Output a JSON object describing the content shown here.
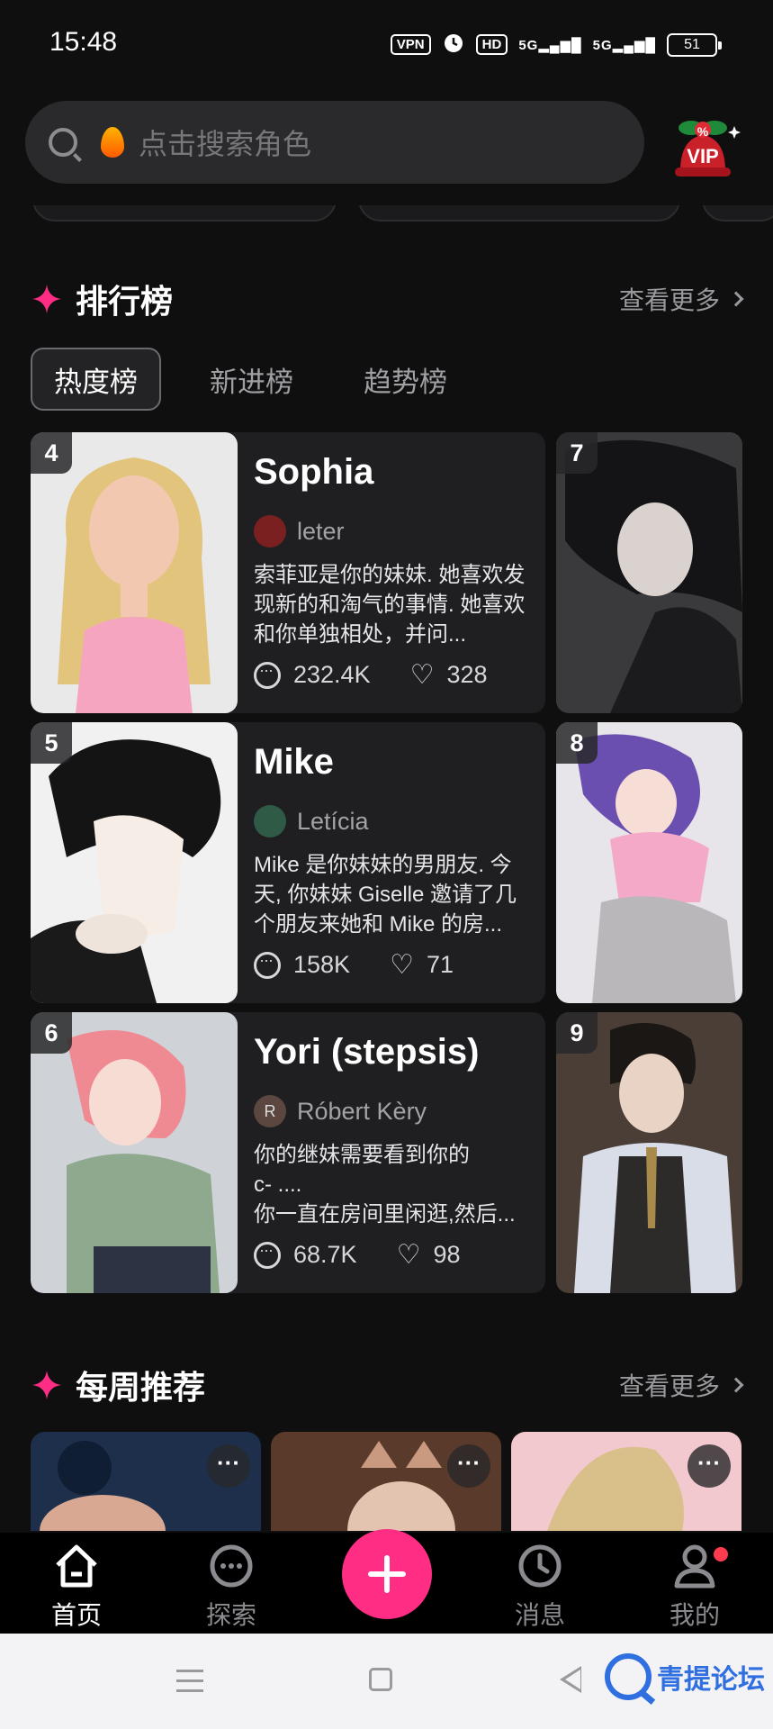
{
  "status": {
    "time": "15:48",
    "vpn": "VPN",
    "hd": "HD",
    "sig1": "5G",
    "sig2": "5G",
    "battery": "51"
  },
  "search": {
    "placeholder": "点击搜索角色"
  },
  "vip": {
    "label": "VIP",
    "badge": "%"
  },
  "ranking": {
    "title": "排行榜",
    "more": "查看更多",
    "tabs": [
      "热度榜",
      "新进榜",
      "趋势榜"
    ],
    "cards": [
      {
        "rank": "4",
        "name": "Sophia",
        "author": "leter",
        "desc": "索菲亚是你的妹妹. 她喜欢发现新的和淘气的事情. 她喜欢和你单独相处，并问...",
        "chats": "232.4K",
        "likes": "328"
      },
      {
        "rank": "5",
        "name": "Mike",
        "author": "Letícia",
        "desc": "Mike 是你妹妹的男朋友. 今天, 你妹妹 Giselle 邀请了几个朋友来她和 Mike 的房...",
        "chats": "158K",
        "likes": "71"
      },
      {
        "rank": "6",
        "name": "Yori (stepsis)",
        "author": "Róbert Kèry",
        "author_initial": "R",
        "desc": "你的继妹需要看到你的\nc- ....\n你一直在房间里闲逛,然后...",
        "chats": "68.7K",
        "likes": "98"
      }
    ],
    "side": [
      {
        "rank": "7"
      },
      {
        "rank": "8"
      },
      {
        "rank": "9"
      }
    ]
  },
  "weekly": {
    "title": "每周推荐",
    "more": "查看更多",
    "menu": "···"
  },
  "nav": {
    "home": "首页",
    "explore": "探索",
    "messages": "消息",
    "mine": "我的"
  },
  "watermark": {
    "text": "青提论坛"
  },
  "colors": {
    "accent": "#ff2d84",
    "background": "#0f0f10",
    "card": "#1f1f21"
  }
}
